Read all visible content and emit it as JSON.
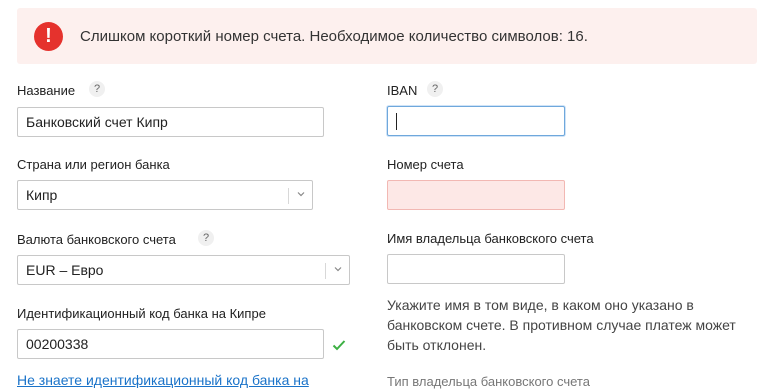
{
  "alert": {
    "icon": "exclamation-icon",
    "icon_glyph": "!",
    "message": "Слишком короткий номер счета. Необходимое количество символов: 16."
  },
  "form": {
    "name": {
      "label": "Название",
      "help": "?",
      "value": "Банковский счет Кипр"
    },
    "iban": {
      "label": "IBAN",
      "help": "?",
      "value": ""
    },
    "country": {
      "label": "Страна или регион банка",
      "value": "Кипр"
    },
    "account_number": {
      "label": "Номер счета",
      "value": ""
    },
    "currency": {
      "label": "Валюта банковского счета",
      "help": "?",
      "value": "EUR – Евро"
    },
    "holder_name": {
      "label": "Имя владельца банковского счета",
      "value": "",
      "hint": "Укажите имя в том виде, в каком оно указано в банковском счете. В противном случае платеж может быть отклонен."
    },
    "bank_code": {
      "label": "Идентификационный код банка на Кипре",
      "value": "00200338"
    },
    "bank_code_link": "Не знаете идентификационный код банка на",
    "account_type_label": "Тип владельца банковского счета"
  },
  "colors": {
    "error_icon": "#e5322d",
    "alert_bg": "#fdf0ee",
    "link": "#1a73c9",
    "success_check": "#3cb043"
  }
}
